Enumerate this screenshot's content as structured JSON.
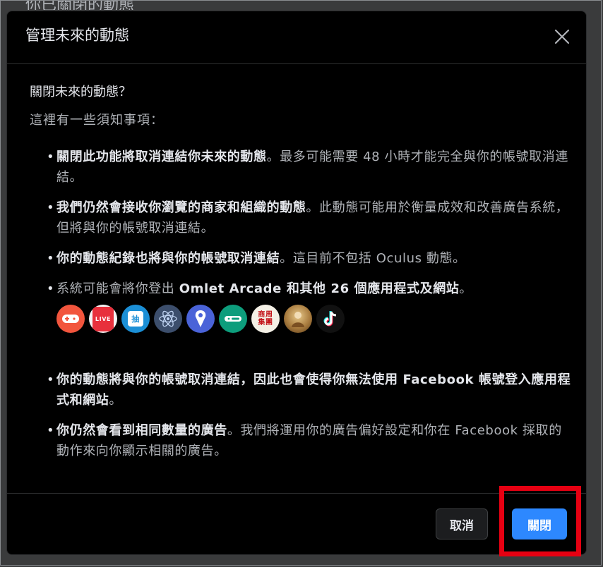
{
  "background": {
    "title": "你已關閉的動態"
  },
  "dialog": {
    "title": "管理未來的動態",
    "question": "關閉未來的動態？",
    "intro": "這裡有一些須知事項：",
    "points": [
      {
        "bold": "關閉此功能將取消連結你未來的動態",
        "text": "。最多可能需要 48 小時才能完全與你的帳號取消連結。"
      },
      {
        "bold": "我們仍然會接收你瀏覽的商家和組織的動態",
        "text": "。此動態可能用於衡量成效和改善廣告系統，但將與你的帳號取消連結。"
      },
      {
        "bold": "你的動態紀錄也將與你的帳號取消連結",
        "text": "。這目前不包括 Oculus 動態。"
      },
      {
        "prefix": "系統可能會將你登出 ",
        "bold": "Omlet Arcade 和其他 26 個應用程式及網站",
        "suffix": "。"
      },
      {
        "bold": "你的動態將與你的帳號取消連結，因此也會使得你無法使用 Facebook 帳號登入應用程式和網站",
        "text": "。"
      },
      {
        "bold": "你仍然會看到相同數量的廣告",
        "text": "。我們將運用你的廣告偏好設定和你在 Facebook 採取的動作來向你顯示相關的廣告。"
      }
    ],
    "apps": [
      {
        "icon": "gamepad-app-icon",
        "color": "#f2553d"
      },
      {
        "icon": "live-camera-app-icon",
        "color": "#f4f4f4",
        "label": "LIVE"
      },
      {
        "icon": "lottery-app-icon",
        "color": "#1b8fd6",
        "label": "抽"
      },
      {
        "icon": "atom-app-icon",
        "color": "#3c4e6c"
      },
      {
        "icon": "map-pin-app-icon",
        "color": "#4a63d8"
      },
      {
        "icon": "green-chat-app-icon",
        "color": "#0d9d7c"
      },
      {
        "icon": "business-news-app-icon",
        "color": "#f4f0e6",
        "label": "商周集團"
      },
      {
        "icon": "game-character-app-icon",
        "color": "#a87b3e"
      },
      {
        "icon": "tiktok-app-icon",
        "color": "#111111"
      }
    ],
    "buttons": {
      "cancel": "取消",
      "confirm": "關閉"
    }
  }
}
